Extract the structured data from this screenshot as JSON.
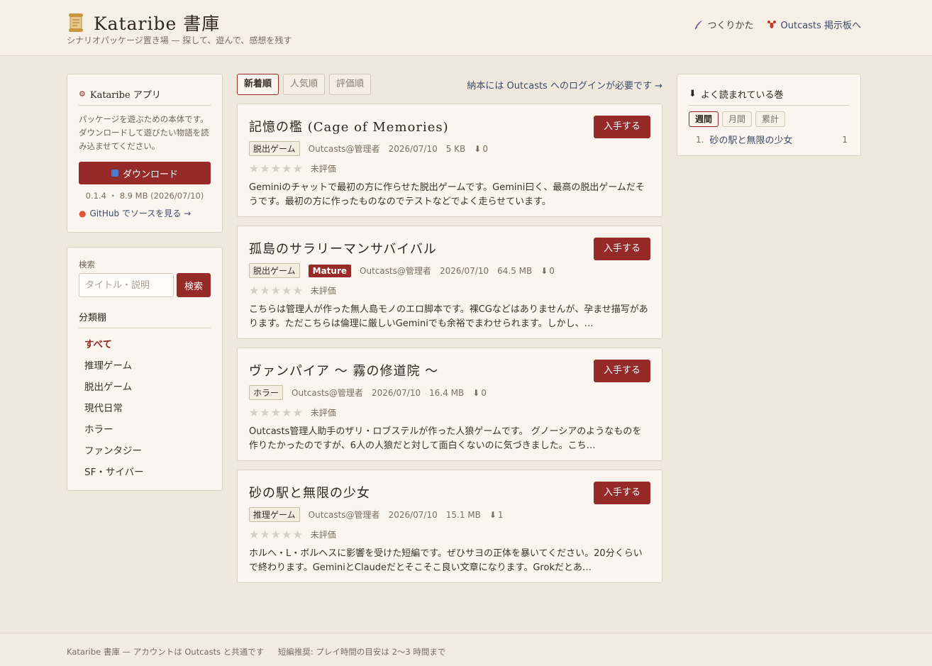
{
  "header": {
    "icon": "scroll-icon",
    "title": "Kataribe 書庫",
    "subtitle": "シナリオパッケージ置き場 — 探して、遊んで、感想を残す",
    "nav": [
      {
        "icon": "quill-icon",
        "label": "つくりかた"
      },
      {
        "icon": "lobster-icon",
        "label": "Outcasts 掲示板へ"
      }
    ]
  },
  "app_panel": {
    "title": "Kataribe アプリ",
    "description": "パッケージを遊ぶための本体です。ダウンロードして遊びたい物語を読み込ませてください。",
    "download_label": "ダウンロード",
    "version_meta": "0.1.4 ・ 8.9 MB (2026/07/10)",
    "github_label": "GitHub でソースを見る →"
  },
  "search": {
    "label": "検索",
    "placeholder": "タイトル・説明",
    "button": "検索"
  },
  "categories": {
    "title": "分類棚",
    "items": [
      "すべて",
      "推理ゲーム",
      "脱出ゲーム",
      "現代日常",
      "ホラー",
      "ファンタジー",
      "SF・サイバー"
    ],
    "active_index": 0
  },
  "sort": {
    "tabs": [
      "新着順",
      "人気順",
      "評価順"
    ],
    "active_index": 0,
    "login_note": "納本には Outcasts へのログインが必要です →"
  },
  "cards": [
    {
      "title": "記憶の檻 (Cage of Memories)",
      "get_label": "入手する",
      "tag": "脱出ゲーム",
      "mature": "",
      "author": "Outcasts@管理者",
      "date": "2026/07/10",
      "size": "5 KB",
      "downloads": "0",
      "stars": "★★★★★",
      "rating_text": "未評価",
      "description": "Geminiのチャットで最初の方に作らせた脱出ゲームです。Gemini曰く、最高の脱出ゲームだそうです。最初の方に作ったものなのでテストなどでよく走らせています。"
    },
    {
      "title": "孤島のサラリーマンサバイバル",
      "get_label": "入手する",
      "tag": "脱出ゲーム",
      "mature": "Mature",
      "author": "Outcasts@管理者",
      "date": "2026/07/10",
      "size": "64.5 MB",
      "downloads": "0",
      "stars": "★★★★★",
      "rating_text": "未評価",
      "description": "こちらは管理人が作った無人島モノのエロ脚本です。裸CGなどはありませんが、孕ませ描写があります。ただこちらは倫理に厳しいGeminiでも余裕でまわせられます。しかし、…"
    },
    {
      "title": "ヴァンパイア 〜 霧の修道院 〜",
      "get_label": "入手する",
      "tag": "ホラー",
      "mature": "",
      "author": "Outcasts@管理者",
      "date": "2026/07/10",
      "size": "16.4 MB",
      "downloads": "0",
      "stars": "★★★★★",
      "rating_text": "未評価",
      "description": "Outcasts管理人助手のザリ・ロブステルが作った人狼ゲームです。 グノーシアのようなものを作りたかったのですが、6人の人狼だと対して面白くないのに気づきました。こち…"
    },
    {
      "title": "砂の駅と無限の少女",
      "get_label": "入手する",
      "tag": "推理ゲーム",
      "mature": "",
      "author": "Outcasts@管理者",
      "date": "2026/07/10",
      "size": "15.1 MB",
      "downloads": "1",
      "stars": "★★★★★",
      "rating_text": "未評価",
      "description": "ホルヘ・L・ボルヘスに影響を受けた短編です。ぜひサヨの正体を暴いてください。20分くらいで終わります。GeminiとClaudeだとそこそこ良い文章になります。Grokだとあ…"
    }
  ],
  "ranking": {
    "title": "よく読まれている巻",
    "tabs": [
      "週間",
      "月間",
      "累計"
    ],
    "active_index": 0,
    "items": [
      {
        "rank": "1.",
        "name": "砂の駅と無限の少女",
        "count": "1"
      }
    ]
  },
  "footer": {
    "left": "Kataribe 書庫 — アカウントは Outcasts と共通です",
    "right": "短編推奨: プレイ時間の目安は 2〜3 時間まで"
  },
  "colors": {
    "accent": "#962a28",
    "link": "#3d4a6a",
    "background": "#efe8dc",
    "panel": "#faf6ef"
  }
}
